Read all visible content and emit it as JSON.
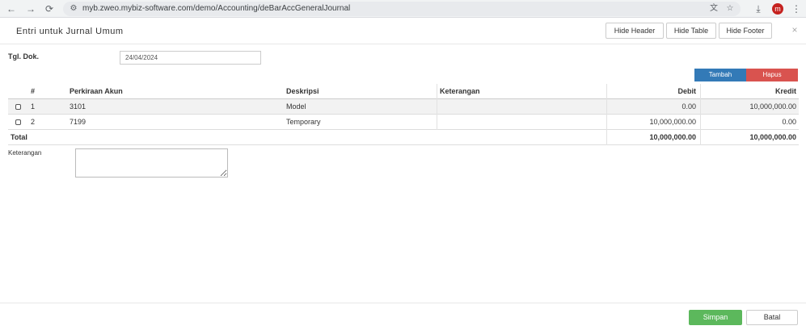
{
  "browser": {
    "url": "myb.zweo.mybiz-software.com/demo/Accounting/deBarAccGeneralJournal",
    "back_icon": "←",
    "forward_icon": "→",
    "reload_icon": "⟳",
    "site_icon": "⚙",
    "translate_icon": "文",
    "star_icon": "☆",
    "download_icon": "⤓",
    "avatar_letter": "m",
    "menu_icon": "⋮"
  },
  "modal": {
    "title": "Entri untuk Jurnal Umum",
    "close_icon": "×",
    "header_buttons": [
      "Hide Header",
      "Hide Table",
      "Hide Footer"
    ]
  },
  "form": {
    "tgl_label": "Tgl. Dok.",
    "tgl_value": "24/04/2024",
    "add_button": "Tambah",
    "delete_button": "Hapus",
    "keterangan_label": "Keterangan"
  },
  "table": {
    "headers": [
      "#",
      "Perkiraan Akun",
      "Deskripsi",
      "Keterangan",
      "Debit",
      "Kredit"
    ],
    "rows": [
      {
        "no": "1",
        "akun": "3101",
        "deskripsi": "Model",
        "keterangan": "",
        "debit": "0.00",
        "kredit": "10,000,000.00"
      },
      {
        "no": "2",
        "akun": "7199",
        "deskripsi": "Temporary",
        "keterangan": "",
        "debit": "10,000,000.00",
        "kredit": "0.00"
      }
    ],
    "total_label": "Total",
    "total_debit": "10,000,000.00",
    "total_kredit": "10,000,000.00"
  },
  "footer": {
    "save_button": "Simpan",
    "cancel_button": "Batal"
  }
}
